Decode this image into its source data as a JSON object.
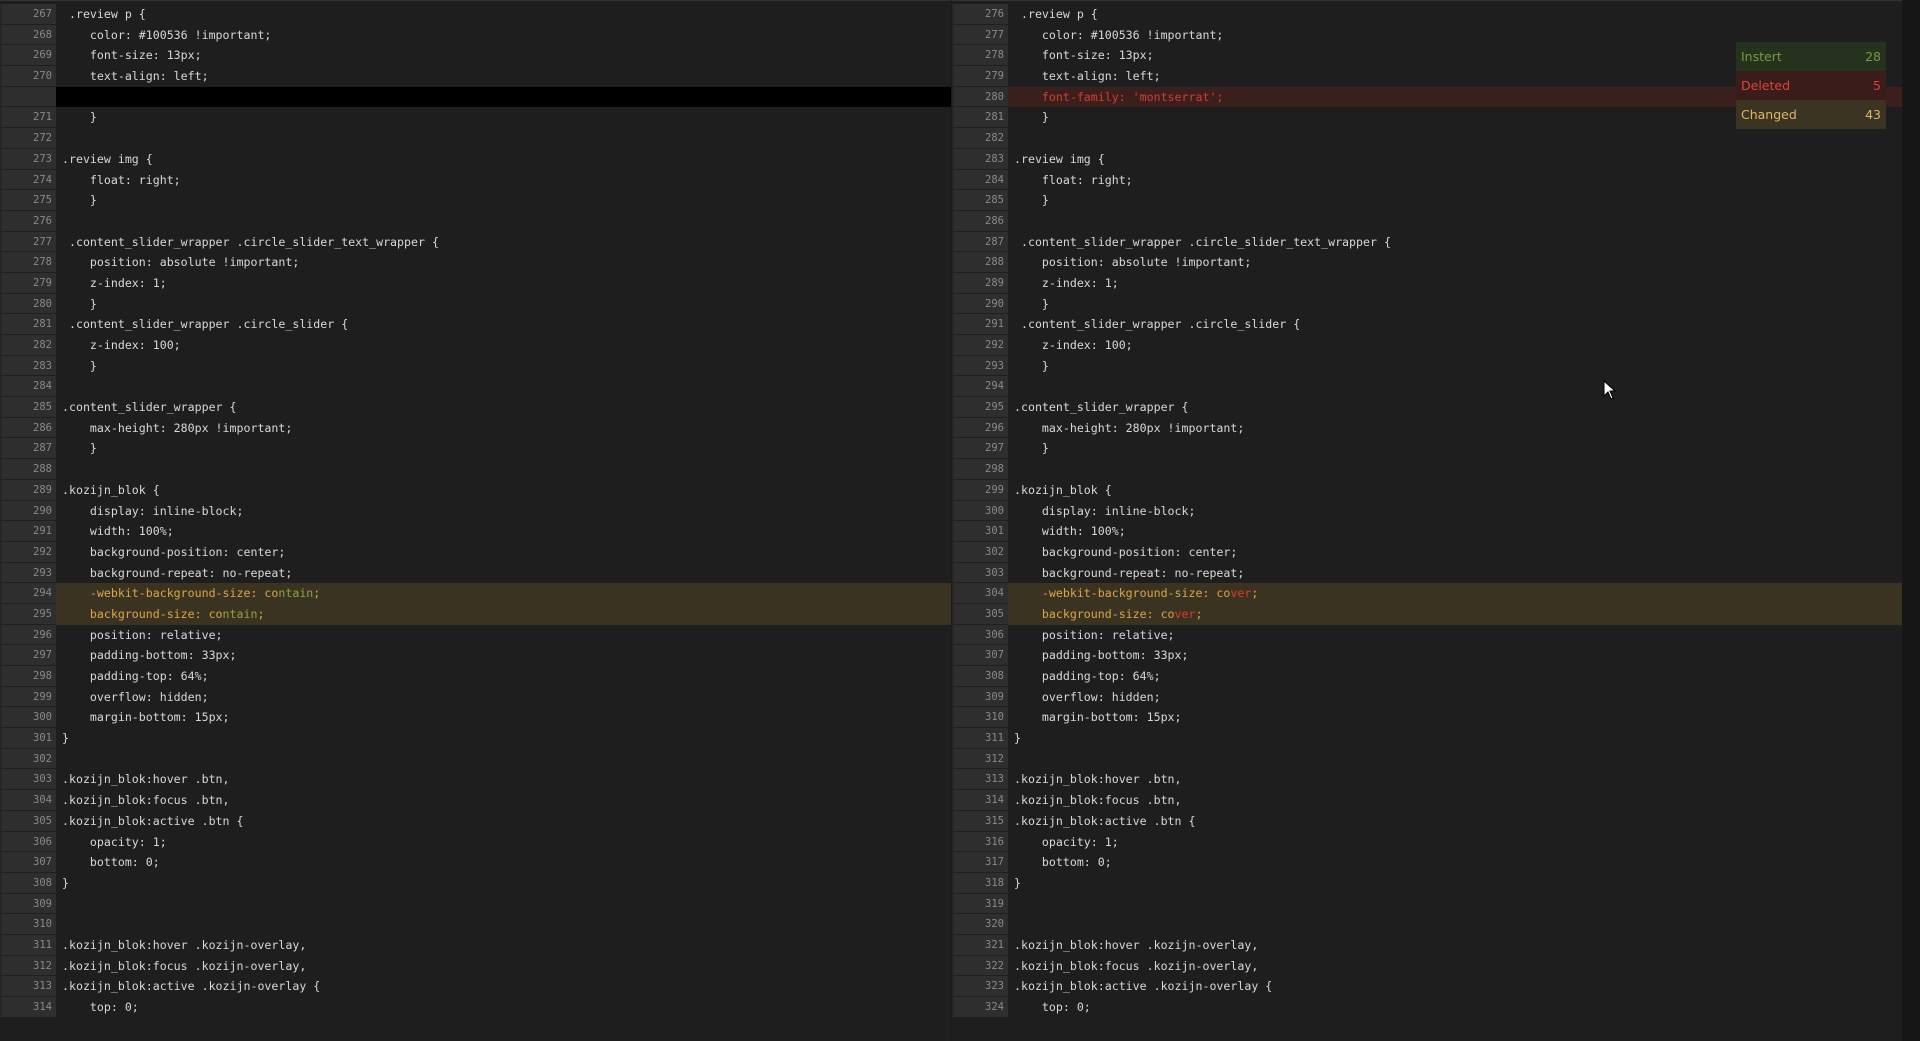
{
  "left": {
    "rows": [
      {
        "n": "267",
        "t": " .review p {"
      },
      {
        "n": "268",
        "t": "    color: #100536 !important;"
      },
      {
        "n": "269",
        "t": "    font-size: 13px;"
      },
      {
        "n": "270",
        "t": "    text-align: left;"
      },
      {
        "n": "",
        "t": "",
        "type": "placeholder"
      },
      {
        "n": "271",
        "t": "    }"
      },
      {
        "n": "272",
        "t": ""
      },
      {
        "n": "273",
        "t": ".review img {"
      },
      {
        "n": "274",
        "t": "    float: right;"
      },
      {
        "n": "275",
        "t": "    }"
      },
      {
        "n": "276",
        "t": ""
      },
      {
        "n": "277",
        "t": " .content_slider_wrapper .circle_slider_text_wrapper {"
      },
      {
        "n": "278",
        "t": "    position: absolute !important;"
      },
      {
        "n": "279",
        "t": "    z-index: 1;"
      },
      {
        "n": "280",
        "t": "    }"
      },
      {
        "n": "281",
        "t": " .content_slider_wrapper .circle_slider {"
      },
      {
        "n": "282",
        "t": "    z-index: 100;"
      },
      {
        "n": "283",
        "t": "    }"
      },
      {
        "n": "284",
        "t": ""
      },
      {
        "n": "285",
        "t": ".content_slider_wrapper {"
      },
      {
        "n": "286",
        "t": "    max-height: 280px !important;"
      },
      {
        "n": "287",
        "t": "    }"
      },
      {
        "n": "288",
        "t": ""
      },
      {
        "n": "289",
        "t": ".kozijn_blok {"
      },
      {
        "n": "290",
        "t": "    display: inline-block;"
      },
      {
        "n": "291",
        "t": "    width: 100%;"
      },
      {
        "n": "292",
        "t": "    background-position: center;"
      },
      {
        "n": "293",
        "t": "    background-repeat: no-repeat;"
      },
      {
        "n": "294",
        "type": "changed",
        "t": "    -webkit-background-size: co",
        "hl": "ntain",
        "tail": ";"
      },
      {
        "n": "295",
        "type": "changed",
        "t": "    background-size: co",
        "hl": "ntain",
        "tail": ";"
      },
      {
        "n": "296",
        "t": "    position: relative;"
      },
      {
        "n": "297",
        "t": "    padding-bottom: 33px;"
      },
      {
        "n": "298",
        "t": "    padding-top: 64%;"
      },
      {
        "n": "299",
        "t": "    overflow: hidden;"
      },
      {
        "n": "300",
        "t": "    margin-bottom: 15px;"
      },
      {
        "n": "301",
        "t": "}"
      },
      {
        "n": "302",
        "t": ""
      },
      {
        "n": "303",
        "t": ".kozijn_blok:hover .btn,"
      },
      {
        "n": "304",
        "t": ".kozijn_blok:focus .btn,"
      },
      {
        "n": "305",
        "t": ".kozijn_blok:active .btn {"
      },
      {
        "n": "306",
        "t": "    opacity: 1;"
      },
      {
        "n": "307",
        "t": "    bottom: 0;"
      },
      {
        "n": "308",
        "t": "}"
      },
      {
        "n": "309",
        "t": ""
      },
      {
        "n": "310",
        "t": ""
      },
      {
        "n": "311",
        "t": ".kozijn_blok:hover .kozijn-overlay,"
      },
      {
        "n": "312",
        "t": ".kozijn_blok:focus .kozijn-overlay,"
      },
      {
        "n": "313",
        "t": ".kozijn_blok:active .kozijn-overlay {"
      },
      {
        "n": "314",
        "t": "    top: 0;"
      }
    ]
  },
  "right": {
    "rows": [
      {
        "n": "276",
        "t": " .review p {"
      },
      {
        "n": "277",
        "t": "    color: #100536 !important;"
      },
      {
        "n": "278",
        "t": "    font-size: 13px;"
      },
      {
        "n": "279",
        "t": "    text-align: left;"
      },
      {
        "n": "280",
        "t": "    font-family: 'montserrat';",
        "type": "deleted"
      },
      {
        "n": "281",
        "t": "    }"
      },
      {
        "n": "282",
        "t": ""
      },
      {
        "n": "283",
        "t": ".review img {"
      },
      {
        "n": "284",
        "t": "    float: right;"
      },
      {
        "n": "285",
        "t": "    }"
      },
      {
        "n": "286",
        "t": ""
      },
      {
        "n": "287",
        "t": " .content_slider_wrapper .circle_slider_text_wrapper {"
      },
      {
        "n": "288",
        "t": "    position: absolute !important;"
      },
      {
        "n": "289",
        "t": "    z-index: 1;"
      },
      {
        "n": "290",
        "t": "    }"
      },
      {
        "n": "291",
        "t": " .content_slider_wrapper .circle_slider {"
      },
      {
        "n": "292",
        "t": "    z-index: 100;"
      },
      {
        "n": "293",
        "t": "    }"
      },
      {
        "n": "294",
        "t": ""
      },
      {
        "n": "295",
        "t": ".content_slider_wrapper {"
      },
      {
        "n": "296",
        "t": "    max-height: 280px !important;"
      },
      {
        "n": "297",
        "t": "    }"
      },
      {
        "n": "298",
        "t": ""
      },
      {
        "n": "299",
        "t": ".kozijn_blok {"
      },
      {
        "n": "300",
        "t": "    display: inline-block;"
      },
      {
        "n": "301",
        "t": "    width: 100%;"
      },
      {
        "n": "302",
        "t": "    background-position: center;"
      },
      {
        "n": "303",
        "t": "    background-repeat: no-repeat;"
      },
      {
        "n": "304",
        "type": "changed",
        "t": "    -webkit-background-size: co",
        "hl": "ver",
        "tail": ";"
      },
      {
        "n": "305",
        "type": "changed",
        "t": "    background-size: co",
        "hl": "ver",
        "tail": ";"
      },
      {
        "n": "306",
        "t": "    position: relative;"
      },
      {
        "n": "307",
        "t": "    padding-bottom: 33px;"
      },
      {
        "n": "308",
        "t": "    padding-top: 64%;"
      },
      {
        "n": "309",
        "t": "    overflow: hidden;"
      },
      {
        "n": "310",
        "t": "    margin-bottom: 15px;"
      },
      {
        "n": "311",
        "t": "}"
      },
      {
        "n": "312",
        "t": ""
      },
      {
        "n": "313",
        "t": ".kozijn_blok:hover .btn,"
      },
      {
        "n": "314",
        "t": ".kozijn_blok:focus .btn,"
      },
      {
        "n": "315",
        "t": ".kozijn_blok:active .btn {"
      },
      {
        "n": "316",
        "t": "    opacity: 1;"
      },
      {
        "n": "317",
        "t": "    bottom: 0;"
      },
      {
        "n": "318",
        "t": "}"
      },
      {
        "n": "319",
        "t": ""
      },
      {
        "n": "320",
        "t": ""
      },
      {
        "n": "321",
        "t": ".kozijn_blok:hover .kozijn-overlay,"
      },
      {
        "n": "322",
        "t": ".kozijn_blok:focus .kozijn-overlay,"
      },
      {
        "n": "323",
        "t": ".kozijn_blok:active .kozijn-overlay {"
      },
      {
        "n": "324",
        "t": "    top: 0;"
      }
    ]
  },
  "legend": {
    "insert": {
      "label": "Instert",
      "count": "28",
      "color": "#79993d"
    },
    "deleted": {
      "label": "Deleted",
      "count": "5",
      "color": "#dc4538"
    },
    "changed": {
      "label": "Changed",
      "count": "43",
      "color": "#e2b466"
    }
  },
  "cursor": {
    "icon": "mouse-pointer-icon"
  }
}
